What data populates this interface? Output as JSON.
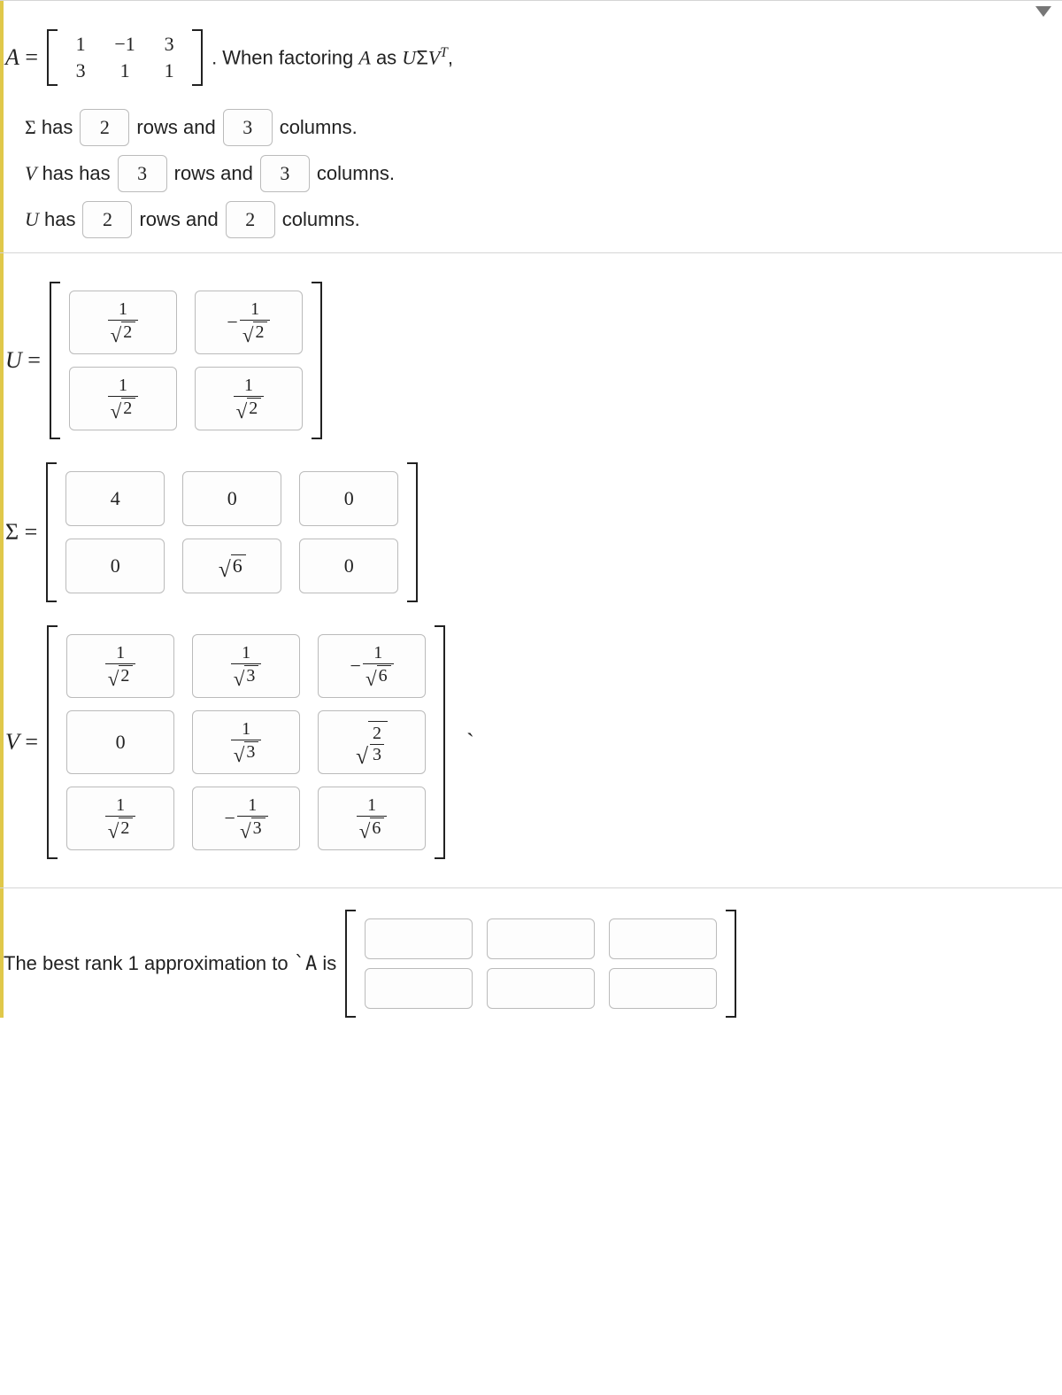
{
  "intro": {
    "A_label": "A",
    "equals": "=",
    "matrix_A": [
      [
        "1",
        "−1",
        "3"
      ],
      [
        "3",
        "1",
        "1"
      ]
    ],
    "sentence_tail": ". When factoring ",
    "A_as": " as ",
    "U": "U",
    "Sigma": "Σ",
    "V": "V",
    "T": "T",
    "comma": ","
  },
  "dims": {
    "sigma": {
      "pre": "Σ has",
      "rows": "2",
      "mid": "rows and",
      "cols": "3",
      "post": "columns."
    },
    "V": {
      "pre": "V has has",
      "rows": "3",
      "mid": "rows and",
      "cols": "3",
      "post": "columns."
    },
    "U": {
      "pre": "U has",
      "rows": "2",
      "mid": "rows and",
      "cols": "2",
      "post": "columns."
    }
  },
  "matrices": {
    "U": {
      "label": "U =",
      "rows": 2,
      "cols": 2,
      "cells": [
        {
          "type": "frac",
          "num": "1",
          "denSqrt": "2"
        },
        {
          "type": "negfrac",
          "num": "1",
          "denSqrt": "2"
        },
        {
          "type": "frac",
          "num": "1",
          "denSqrt": "2"
        },
        {
          "type": "frac",
          "num": "1",
          "denSqrt": "2"
        }
      ]
    },
    "Sigma": {
      "label": "Σ =",
      "rows": 2,
      "cols": 3,
      "cells": [
        {
          "type": "plain",
          "val": "4"
        },
        {
          "type": "plain",
          "val": "0"
        },
        {
          "type": "plain",
          "val": "0"
        },
        {
          "type": "plain",
          "val": "0"
        },
        {
          "type": "sqrt",
          "arg": "6"
        },
        {
          "type": "plain",
          "val": "0"
        }
      ]
    },
    "V": {
      "label": "V =",
      "rows": 3,
      "cols": 3,
      "cells": [
        {
          "type": "frac",
          "num": "1",
          "denSqrt": "2"
        },
        {
          "type": "frac",
          "num": "1",
          "denSqrt": "3"
        },
        {
          "type": "negfrac",
          "num": "1",
          "denSqrt": "6"
        },
        {
          "type": "plain",
          "val": "0"
        },
        {
          "type": "frac",
          "num": "1",
          "denSqrt": "3"
        },
        {
          "type": "sqrtfrac",
          "num": "2",
          "den": "3"
        },
        {
          "type": "frac",
          "num": "1",
          "denSqrt": "2"
        },
        {
          "type": "negfrac",
          "num": "1",
          "denSqrt": "3"
        },
        {
          "type": "frac",
          "num": "1",
          "denSqrt": "6"
        }
      ]
    }
  },
  "rank1": {
    "text_before": "The best rank 1 approximation to ",
    "A_token": "`A",
    "text_after": " is",
    "rows": 2,
    "cols": 3
  }
}
